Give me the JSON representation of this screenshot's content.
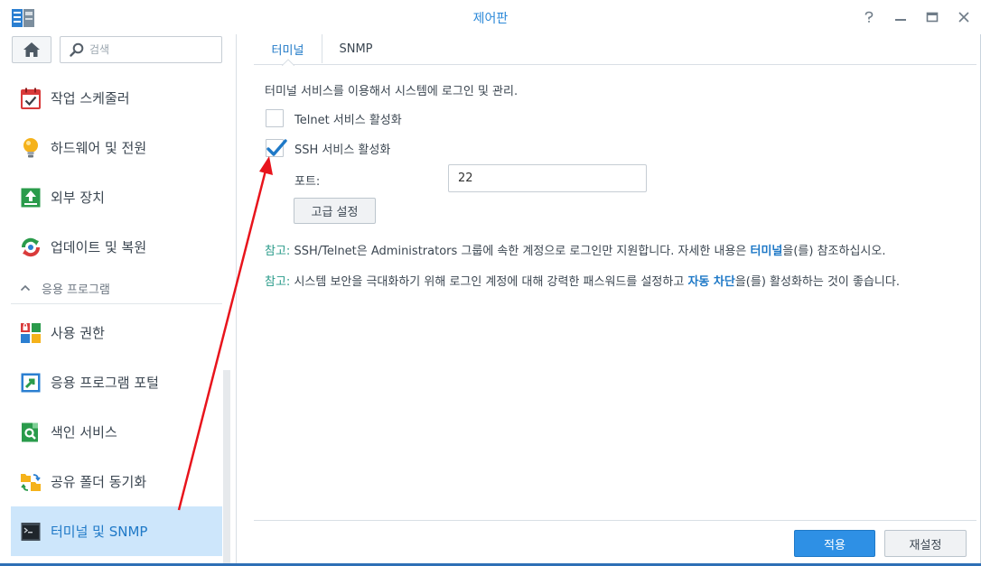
{
  "window": {
    "title": "제어판"
  },
  "sidebar": {
    "search_placeholder": "검색",
    "items_top": [
      {
        "label": "작업 스케줄러",
        "icon": "calendar-check-icon"
      },
      {
        "label": "하드웨어 및 전원",
        "icon": "lightbulb-icon"
      },
      {
        "label": "외부 장치",
        "icon": "external-device-icon"
      },
      {
        "label": "업데이트 및 복원",
        "icon": "update-restore-icon"
      }
    ],
    "section_label": "응용 프로그램",
    "items_apps": [
      {
        "label": "사용 권한",
        "icon": "privileges-icon"
      },
      {
        "label": "응용 프로그램 포털",
        "icon": "app-portal-icon"
      },
      {
        "label": "색인 서비스",
        "icon": "indexing-search-icon"
      },
      {
        "label": "공유 폴더 동기화",
        "icon": "shared-folder-sync-icon"
      },
      {
        "label": "터미널 및 SNMP",
        "icon": "terminal-icon",
        "active": true
      }
    ]
  },
  "tabs": [
    {
      "label": "터미널",
      "active": true
    },
    {
      "label": "SNMP",
      "active": false
    }
  ],
  "terminal": {
    "description": "터미널 서비스를 이용해서 시스템에 로그인 및 관리.",
    "telnet_label": "Telnet 서비스 활성화",
    "telnet_checked": false,
    "ssh_label": "SSH 서비스 활성화",
    "ssh_checked": true,
    "port_label": "포트:",
    "port_value": "22",
    "advanced_button": "고급 설정"
  },
  "notes": [
    {
      "prefix": "참고:",
      "text_before": " SSH/Telnet은 Administrators 그룹에 속한 계정으로 로그인만 지원합니다. 자세한 내용은 ",
      "link": "터미널",
      "text_after": "을(를) 참조하십시오."
    },
    {
      "prefix": "참고:",
      "text_before": " 시스템 보안을 극대화하기 위해 로그인 계정에 대해 강력한 패스워드를 설정하고 ",
      "link": "자동 차단",
      "text_after": "을(를) 활성화하는 것이 좋습니다."
    }
  ],
  "footer": {
    "apply_label": "적용",
    "reset_label": "재설정"
  },
  "colors": {
    "accent": "#2e90e5",
    "title_blue": "#2b88d8",
    "active_bg": "#cde6fb",
    "note_prefix": "#2a9b8a",
    "annotation_arrow": "#e8141c"
  }
}
